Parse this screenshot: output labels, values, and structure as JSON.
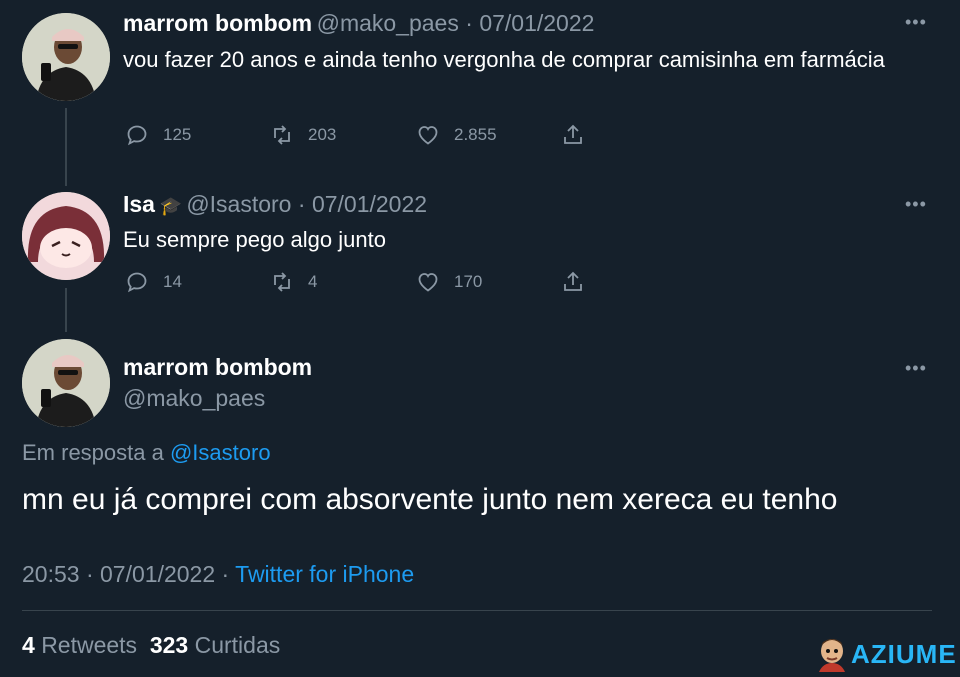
{
  "tweet1": {
    "name": "marrom bombom",
    "handle": "@mako_paes",
    "date": "07/01/2022",
    "text": "vou fazer 20 anos e ainda tenho vergonha de comprar camisinha em farmácia",
    "replies": "125",
    "retweets": "203",
    "likes": "2.855"
  },
  "tweet2": {
    "name": "Isa",
    "badge": "🎓",
    "handle": "@Isastoro",
    "date": "07/01/2022",
    "text": "Eu sempre pego algo junto",
    "replies": "14",
    "retweets": "4",
    "likes": "170"
  },
  "main": {
    "name": "marrom bombom",
    "handle": "@mako_paes",
    "reply_prefix": "Em resposta a",
    "reply_to": "@Isastoro",
    "text": "mn eu já comprei com absorvente junto nem xereca eu tenho",
    "time": "20:53",
    "date": "07/01/2022",
    "source": "Twitter for iPhone",
    "retweet_count": "4",
    "retweet_label": "Retweets",
    "like_count": "323",
    "like_label": "Curtidas"
  },
  "watermark": "AZIUME",
  "colors": {
    "background": "#15202b",
    "muted": "#8b98a5",
    "link": "#1d9bf0",
    "line": "#38444d"
  }
}
